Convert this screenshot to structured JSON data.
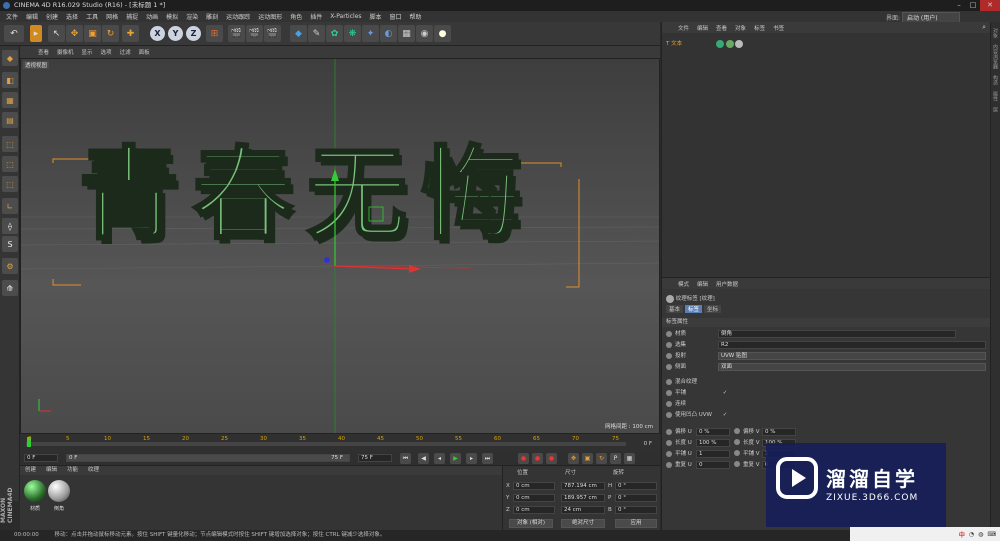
{
  "titlebar": {
    "title": "CINEMA 4D R16.029 Studio (R16) - [未标题 1 *]"
  },
  "menu": [
    "文件",
    "编辑",
    "创建",
    "选择",
    "工具",
    "网格",
    "捕捉",
    "动画",
    "模拟",
    "渲染",
    "雕刻",
    "运动跟踪",
    "运动图形",
    "角色",
    "插件",
    "X-Particles",
    "脚本",
    "窗口",
    "帮助"
  ],
  "layout": {
    "label": "界面:",
    "value": "启动 (用户)"
  },
  "toolbar": {
    "axes": [
      "X",
      "Y",
      "Z"
    ]
  },
  "viewport": {
    "menu": [
      "查看",
      "摄像机",
      "显示",
      "选项",
      "过滤",
      "面板"
    ],
    "label": "透视视图",
    "text3d": "青春无悔",
    "grid_info": "网格间距 : 100 cm"
  },
  "timeline": {
    "ticks": [
      "0",
      "5",
      "10",
      "15",
      "20",
      "25",
      "30",
      "35",
      "40",
      "45",
      "50",
      "55",
      "60",
      "65",
      "70",
      "75"
    ],
    "end": "0 F"
  },
  "controls": {
    "start": "0 F",
    "current": "0 F",
    "end": "75 F",
    "end2": "75 F"
  },
  "materials": {
    "tabs": [
      "创建",
      "编辑",
      "功能",
      "纹理"
    ],
    "items": [
      "材质",
      "倒角"
    ]
  },
  "coords": {
    "headers": [
      "位置",
      "尺寸",
      "旋转"
    ],
    "rows": [
      {
        "axis": "X",
        "pos": "0 cm",
        "size": "787.194 cm",
        "rlabel": "H",
        "rot": "0 °"
      },
      {
        "axis": "Y",
        "pos": "0 cm",
        "size": "189.957 cm",
        "rlabel": "P",
        "rot": "0 °"
      },
      {
        "axis": "Z",
        "pos": "0 cm",
        "size": "24 cm",
        "rlabel": "B",
        "rot": "0 °"
      }
    ],
    "mode": "对象 (相对)",
    "sizemode": "绝对尺寸",
    "apply": "应用"
  },
  "objects": {
    "menu": [
      "文件",
      "编辑",
      "查看",
      "对象",
      "标签",
      "书签"
    ],
    "item": "文本"
  },
  "attributes": {
    "menu": [
      "模式",
      "编辑",
      "用户数据"
    ],
    "tag_title": "纹理标签 [纹理]",
    "tabs": [
      "基本",
      "标签",
      "坐标"
    ],
    "section": "标签属性",
    "rows": [
      {
        "label": "材质",
        "value": "倒角"
      },
      {
        "label": "选集",
        "value": "R2"
      },
      {
        "label": "投射",
        "value": "UVW 贴图"
      },
      {
        "label": "侧面",
        "value": "双面"
      }
    ],
    "checks": [
      {
        "label": "混合纹理",
        "value": ""
      },
      {
        "label": "平铺",
        "value": "✓"
      },
      {
        "label": "连续",
        "value": ""
      },
      {
        "label": "使用凹凸 UVW",
        "value": "✓"
      }
    ],
    "uv": [
      {
        "l": "偏移 U",
        "v": "0 %",
        "l2": "偏移 V",
        "v2": "0 %"
      },
      {
        "l": "长度 U",
        "v": "100 %",
        "l2": "长度 V",
        "v2": "100 %"
      },
      {
        "l": "平铺 U",
        "v": "1",
        "l2": "平铺 V",
        "v2": "1"
      },
      {
        "l": "重复 U",
        "v": "0",
        "l2": "重复 V",
        "v2": "0"
      }
    ]
  },
  "right_strip": [
    "对象",
    "内容浏览器",
    "构造",
    "属性",
    "层"
  ],
  "status": {
    "time": "00:00:00",
    "text": "移动：点击并拖动鼠标移动元素。按住 SHIFT 键量化移动；节点编辑模式时按住 SHIFT 键增加选择对象；按住 CTRL 键减少选择对象。"
  },
  "watermark": {
    "title": "溜溜自学",
    "url": "ZIXUE.3D66.COM"
  },
  "taskbar": {
    "ime": "中",
    "time": ""
  }
}
